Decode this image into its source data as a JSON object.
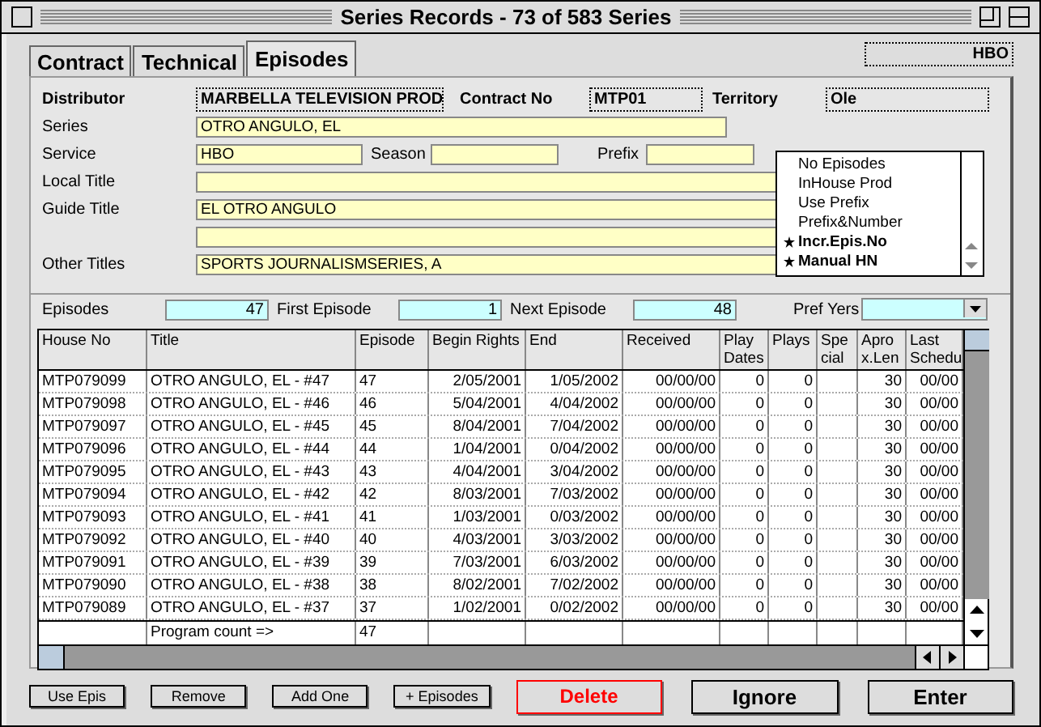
{
  "window": {
    "title": "Series Records - 73 of 583 Series"
  },
  "tabs": [
    {
      "label": "Contract",
      "selected": false
    },
    {
      "label": "Technical",
      "selected": false
    },
    {
      "label": "Episodes",
      "selected": true
    }
  ],
  "service_badge": "HBO",
  "header": {
    "distributor_label": "Distributor",
    "distributor": "MARBELLA TELEVISION PROD",
    "contract_label": "Contract No",
    "contract": "MTP01",
    "territory_label": "Territory",
    "territory": "Ole"
  },
  "form": {
    "series_label": "Series",
    "series": "OTRO ANGULO, EL",
    "service_label": "Service",
    "service": "HBO",
    "season_label": "Season",
    "prefix_label": "Prefix",
    "local_title_label": "Local Title",
    "guide_title_label": "Guide Title",
    "guide_title": "EL OTRO ANGULO",
    "other_titles_label": "Other Titles",
    "other_titles": "SPORTS JOURNALISMSERIES, A"
  },
  "options": [
    {
      "label": "No Episodes",
      "selected": false
    },
    {
      "label": "InHouse Prod",
      "selected": false
    },
    {
      "label": "Use Prefix",
      "selected": false
    },
    {
      "label": "Prefix&Number",
      "selected": false
    },
    {
      "label": "Incr.Epis.No",
      "selected": true
    },
    {
      "label": "Manual HN",
      "selected": true
    }
  ],
  "counts": {
    "episodes_label": "Episodes",
    "episodes": "47",
    "first_label": "First Episode",
    "first": "1",
    "next_label": "Next Episode",
    "next": "48",
    "pref_label": "Pref Yers"
  },
  "table": {
    "columns": [
      "House No",
      "Title",
      "Episode",
      "Begin Rights",
      "End",
      "Received",
      "Play\nDates",
      "Plays",
      "Spe\ncial",
      "Apro\nx.Len",
      "Last\nSchedu"
    ],
    "rows": [
      [
        "MTP079099",
        "OTRO ANGULO, EL - #47",
        "47",
        "2/05/2001",
        "1/05/2002",
        "00/00/00",
        "0",
        "0",
        "",
        "30",
        "00/00"
      ],
      [
        "MTP079098",
        "OTRO ANGULO, EL - #46",
        "46",
        "5/04/2001",
        "4/04/2002",
        "00/00/00",
        "0",
        "0",
        "",
        "30",
        "00/00"
      ],
      [
        "MTP079097",
        "OTRO ANGULO, EL - #45",
        "45",
        "8/04/2001",
        "7/04/2002",
        "00/00/00",
        "0",
        "0",
        "",
        "30",
        "00/00"
      ],
      [
        "MTP079096",
        "OTRO ANGULO, EL - #44",
        "44",
        "1/04/2001",
        "0/04/2002",
        "00/00/00",
        "0",
        "0",
        "",
        "30",
        "00/00"
      ],
      [
        "MTP079095",
        "OTRO ANGULO, EL - #43",
        "43",
        "4/04/2001",
        "3/04/2002",
        "00/00/00",
        "0",
        "0",
        "",
        "30",
        "00/00"
      ],
      [
        "MTP079094",
        "OTRO ANGULO, EL - #42",
        "42",
        "8/03/2001",
        "7/03/2002",
        "00/00/00",
        "0",
        "0",
        "",
        "30",
        "00/00"
      ],
      [
        "MTP079093",
        "OTRO ANGULO, EL - #41",
        "41",
        "1/03/2001",
        "0/03/2002",
        "00/00/00",
        "0",
        "0",
        "",
        "30",
        "00/00"
      ],
      [
        "MTP079092",
        "OTRO ANGULO, EL - #40",
        "40",
        "4/03/2001",
        "3/03/2002",
        "00/00/00",
        "0",
        "0",
        "",
        "30",
        "00/00"
      ],
      [
        "MTP079091",
        "OTRO ANGULO, EL - #39",
        "39",
        "7/03/2001",
        "6/03/2002",
        "00/00/00",
        "0",
        "0",
        "",
        "30",
        "00/00"
      ],
      [
        "MTP079090",
        "OTRO ANGULO, EL - #38",
        "38",
        "8/02/2001",
        "7/02/2002",
        "00/00/00",
        "0",
        "0",
        "",
        "30",
        "00/00"
      ],
      [
        "MTP079089",
        "OTRO ANGULO, EL - #37",
        "37",
        "1/02/2001",
        "0/02/2002",
        "00/00/00",
        "0",
        "0",
        "",
        "30",
        "00/00"
      ]
    ],
    "footer": {
      "label": "Program count =>",
      "count": "47"
    }
  },
  "buttons": [
    {
      "label": "Use Epis",
      "kind": "small"
    },
    {
      "label": "Remove",
      "kind": "small"
    },
    {
      "label": "Add One",
      "kind": "small"
    },
    {
      "label": "+ Episodes",
      "kind": "small"
    },
    {
      "label": "Delete",
      "kind": "danger"
    },
    {
      "label": "Ignore",
      "kind": "large"
    },
    {
      "label": "Enter",
      "kind": "large"
    }
  ]
}
